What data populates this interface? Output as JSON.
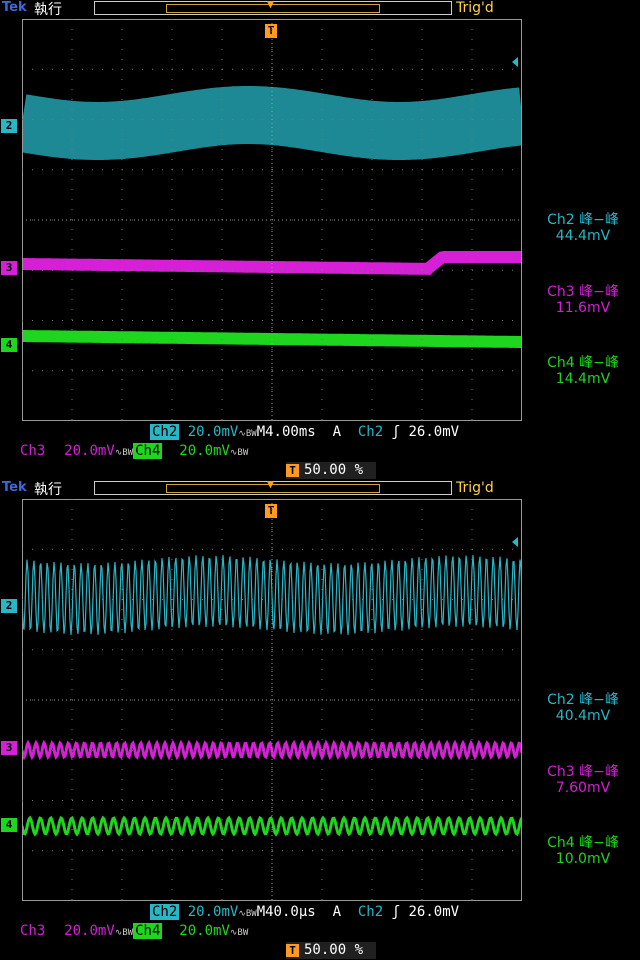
{
  "panels": [
    {
      "brand": "Tek",
      "run_state": "執行",
      "trig_status": "Trig'd",
      "channel_markers": [
        "2",
        "3",
        "4"
      ],
      "trigger_marker": "T",
      "measurements": [
        {
          "label": "Ch2 峰−峰",
          "value": "44.4mV",
          "color": "#27b7c7"
        },
        {
          "label": "Ch3 峰−峰",
          "value": "11.6mV",
          "color": "#d61fd6"
        },
        {
          "label": "Ch4 峰−峰",
          "value": "14.4mV",
          "color": "#1fd61f"
        }
      ],
      "status": {
        "ch2": "Ch2",
        "ch2_scale": "20.0mV",
        "timebase": "M4.00ms",
        "trig_mode": "A",
        "trig_source": "Ch2",
        "trig_slope": "ʃ",
        "trig_level": "26.0mV",
        "ch3": "Ch3",
        "ch3_scale": "20.0mV",
        "ch4": "Ch4",
        "ch4_scale": "20.0mV",
        "bw": "∿BW",
        "trig_pos": "50.00 %"
      },
      "waveform_style": "slow"
    },
    {
      "brand": "Tek",
      "run_state": "執行",
      "trig_status": "Trig'd",
      "channel_markers": [
        "2",
        "3",
        "4"
      ],
      "trigger_marker": "T",
      "measurements": [
        {
          "label": "Ch2 峰−峰",
          "value": "40.4mV",
          "color": "#27b7c7"
        },
        {
          "label": "Ch3 峰−峰",
          "value": "7.60mV",
          "color": "#d61fd6"
        },
        {
          "label": "Ch4 峰−峰",
          "value": "10.0mV",
          "color": "#1fd61f"
        }
      ],
      "status": {
        "ch2": "Ch2",
        "ch2_scale": "20.0mV",
        "timebase": "M40.0µs",
        "trig_mode": "A",
        "trig_source": "Ch2",
        "trig_slope": "ʃ",
        "trig_level": "26.0mV",
        "ch3": "Ch3",
        "ch3_scale": "20.0mV",
        "ch4": "Ch4",
        "ch4_scale": "20.0mV",
        "bw": "∿BW",
        "trig_pos": "50.00 %"
      },
      "waveform_style": "fast"
    }
  ],
  "colors": {
    "ch2": "#27b7c7",
    "ch3": "#d61fd6",
    "ch4": "#1fd61f",
    "trigger": "#ff9b1f"
  }
}
